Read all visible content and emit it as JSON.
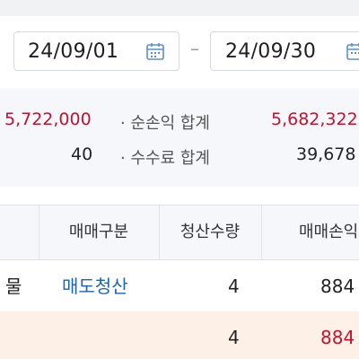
{
  "date_range": {
    "start": "24/09/01",
    "separator": "–",
    "end": "24/09/30"
  },
  "summary": {
    "row1": {
      "left_value": "5,722,000",
      "label": "· 순손익 합계",
      "right_value": "5,682,322"
    },
    "row2": {
      "left_value": "40",
      "label": "· 수수료 합계",
      "right_value": "39,678"
    }
  },
  "table": {
    "headers": [
      "매매구분",
      "청산수량",
      "매매손익"
    ],
    "rows": [
      {
        "product": "물",
        "trade_type": "매도청산",
        "qty": "4",
        "pnl": "884"
      }
    ],
    "total": {
      "qty": "4",
      "pnl": "884"
    }
  },
  "colors": {
    "red": "#c4122f",
    "blue": "#1e62b8",
    "total_row_bg": "#fdf0e6"
  },
  "icons": [
    "calendar-icon"
  ]
}
